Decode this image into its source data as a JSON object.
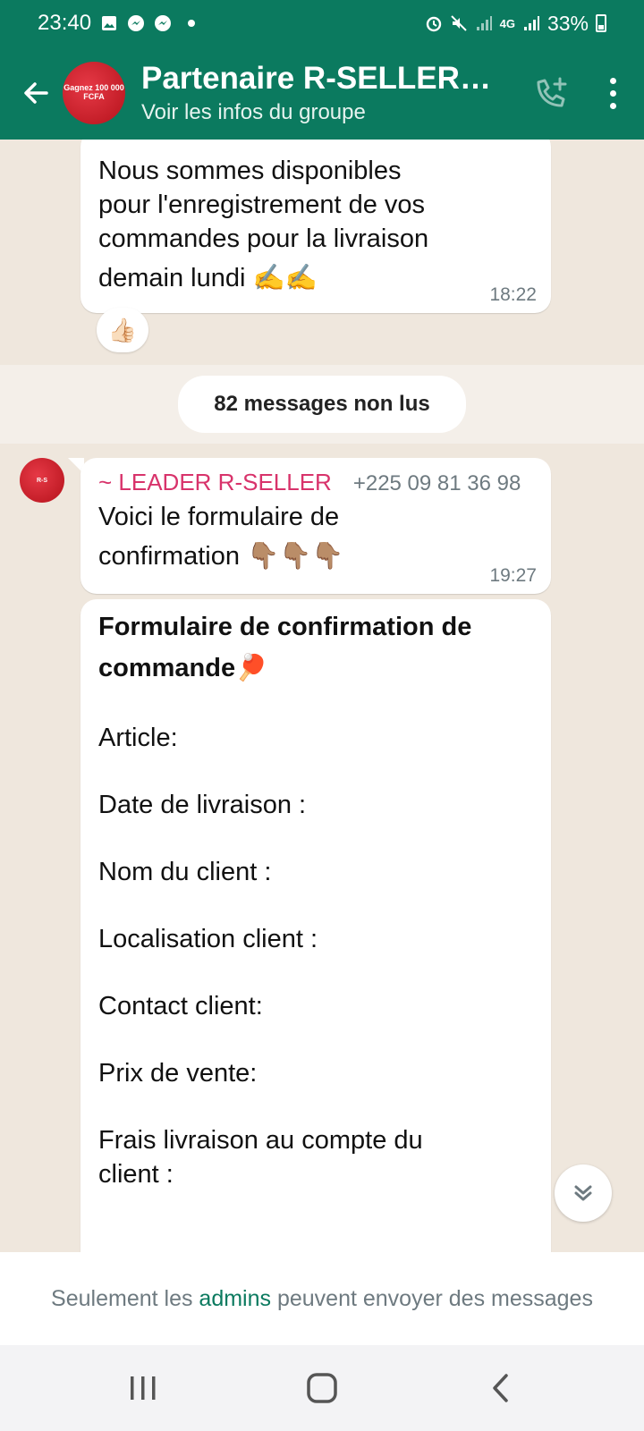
{
  "status_bar": {
    "time": "23:40",
    "battery": "33%",
    "network": "4G"
  },
  "header": {
    "title": "Partenaire R-SELLER V...",
    "subtitle": "Voir les infos du groupe",
    "avatar_text": "Gagnez 100 000 FCFA"
  },
  "messages": {
    "first": {
      "text_line1": "Nous sommes disponibles",
      "text_line2": "pour l'enregistrement de vos",
      "text_line3": "commandes pour la livraison",
      "text_line4": "demain lundi ✍️✍️",
      "time": "18:22",
      "reaction": "👍🏻"
    },
    "unread": "82 messages non lus",
    "second": {
      "sender": "~ LEADER R-SELLER",
      "phone": "+225 09 81 36 98",
      "text_line1": "Voici le formulaire de",
      "text_line2": "confirmation 👇🏽👇🏽👇🏽",
      "time": "19:27"
    },
    "form": {
      "title_line1": "Formulaire de confirmation de",
      "title_line2": "commande🏓",
      "fields": [
        "Article:",
        "Date de livraison :",
        "Nom du client :",
        "Localisation client :",
        "Contact client:",
        "Prix de vente:",
        "Frais livraison au compte du",
        "client :"
      ]
    }
  },
  "footer": {
    "notice_before": "Seulement les ",
    "notice_link": "admins",
    "notice_after": " peuvent envoyer des messages"
  },
  "colors": {
    "primary": "#0b7a5f",
    "sender_name": "#d8336b",
    "chat_bg": "#efe7dd"
  },
  "icons": {
    "back": "back-arrow-icon",
    "call": "add-call-icon",
    "menu": "more-vertical-icon",
    "scroll": "double-chevron-down-icon",
    "nav_recent": "recent-apps-icon",
    "nav_home": "home-icon",
    "nav_back": "nav-back-icon"
  }
}
